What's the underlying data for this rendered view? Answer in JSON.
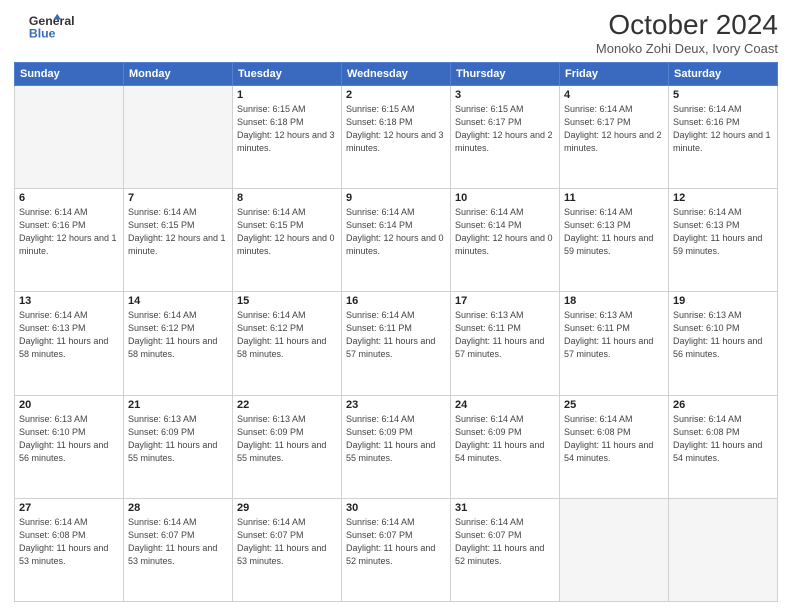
{
  "header": {
    "logo_line1": "General",
    "logo_line2": "Blue",
    "month_title": "October 2024",
    "subtitle": "Monoko Zohi Deux, Ivory Coast"
  },
  "days_of_week": [
    "Sunday",
    "Monday",
    "Tuesday",
    "Wednesday",
    "Thursday",
    "Friday",
    "Saturday"
  ],
  "weeks": [
    [
      {
        "day": "",
        "info": ""
      },
      {
        "day": "",
        "info": ""
      },
      {
        "day": "1",
        "info": "Sunrise: 6:15 AM\nSunset: 6:18 PM\nDaylight: 12 hours and 3 minutes."
      },
      {
        "day": "2",
        "info": "Sunrise: 6:15 AM\nSunset: 6:18 PM\nDaylight: 12 hours and 3 minutes."
      },
      {
        "day": "3",
        "info": "Sunrise: 6:15 AM\nSunset: 6:17 PM\nDaylight: 12 hours and 2 minutes."
      },
      {
        "day": "4",
        "info": "Sunrise: 6:14 AM\nSunset: 6:17 PM\nDaylight: 12 hours and 2 minutes."
      },
      {
        "day": "5",
        "info": "Sunrise: 6:14 AM\nSunset: 6:16 PM\nDaylight: 12 hours and 1 minute."
      }
    ],
    [
      {
        "day": "6",
        "info": "Sunrise: 6:14 AM\nSunset: 6:16 PM\nDaylight: 12 hours and 1 minute."
      },
      {
        "day": "7",
        "info": "Sunrise: 6:14 AM\nSunset: 6:15 PM\nDaylight: 12 hours and 1 minute."
      },
      {
        "day": "8",
        "info": "Sunrise: 6:14 AM\nSunset: 6:15 PM\nDaylight: 12 hours and 0 minutes."
      },
      {
        "day": "9",
        "info": "Sunrise: 6:14 AM\nSunset: 6:14 PM\nDaylight: 12 hours and 0 minutes."
      },
      {
        "day": "10",
        "info": "Sunrise: 6:14 AM\nSunset: 6:14 PM\nDaylight: 12 hours and 0 minutes."
      },
      {
        "day": "11",
        "info": "Sunrise: 6:14 AM\nSunset: 6:13 PM\nDaylight: 11 hours and 59 minutes."
      },
      {
        "day": "12",
        "info": "Sunrise: 6:14 AM\nSunset: 6:13 PM\nDaylight: 11 hours and 59 minutes."
      }
    ],
    [
      {
        "day": "13",
        "info": "Sunrise: 6:14 AM\nSunset: 6:13 PM\nDaylight: 11 hours and 58 minutes."
      },
      {
        "day": "14",
        "info": "Sunrise: 6:14 AM\nSunset: 6:12 PM\nDaylight: 11 hours and 58 minutes."
      },
      {
        "day": "15",
        "info": "Sunrise: 6:14 AM\nSunset: 6:12 PM\nDaylight: 11 hours and 58 minutes."
      },
      {
        "day": "16",
        "info": "Sunrise: 6:14 AM\nSunset: 6:11 PM\nDaylight: 11 hours and 57 minutes."
      },
      {
        "day": "17",
        "info": "Sunrise: 6:13 AM\nSunset: 6:11 PM\nDaylight: 11 hours and 57 minutes."
      },
      {
        "day": "18",
        "info": "Sunrise: 6:13 AM\nSunset: 6:11 PM\nDaylight: 11 hours and 57 minutes."
      },
      {
        "day": "19",
        "info": "Sunrise: 6:13 AM\nSunset: 6:10 PM\nDaylight: 11 hours and 56 minutes."
      }
    ],
    [
      {
        "day": "20",
        "info": "Sunrise: 6:13 AM\nSunset: 6:10 PM\nDaylight: 11 hours and 56 minutes."
      },
      {
        "day": "21",
        "info": "Sunrise: 6:13 AM\nSunset: 6:09 PM\nDaylight: 11 hours and 55 minutes."
      },
      {
        "day": "22",
        "info": "Sunrise: 6:13 AM\nSunset: 6:09 PM\nDaylight: 11 hours and 55 minutes."
      },
      {
        "day": "23",
        "info": "Sunrise: 6:14 AM\nSunset: 6:09 PM\nDaylight: 11 hours and 55 minutes."
      },
      {
        "day": "24",
        "info": "Sunrise: 6:14 AM\nSunset: 6:09 PM\nDaylight: 11 hours and 54 minutes."
      },
      {
        "day": "25",
        "info": "Sunrise: 6:14 AM\nSunset: 6:08 PM\nDaylight: 11 hours and 54 minutes."
      },
      {
        "day": "26",
        "info": "Sunrise: 6:14 AM\nSunset: 6:08 PM\nDaylight: 11 hours and 54 minutes."
      }
    ],
    [
      {
        "day": "27",
        "info": "Sunrise: 6:14 AM\nSunset: 6:08 PM\nDaylight: 11 hours and 53 minutes."
      },
      {
        "day": "28",
        "info": "Sunrise: 6:14 AM\nSunset: 6:07 PM\nDaylight: 11 hours and 53 minutes."
      },
      {
        "day": "29",
        "info": "Sunrise: 6:14 AM\nSunset: 6:07 PM\nDaylight: 11 hours and 53 minutes."
      },
      {
        "day": "30",
        "info": "Sunrise: 6:14 AM\nSunset: 6:07 PM\nDaylight: 11 hours and 52 minutes."
      },
      {
        "day": "31",
        "info": "Sunrise: 6:14 AM\nSunset: 6:07 PM\nDaylight: 11 hours and 52 minutes."
      },
      {
        "day": "",
        "info": ""
      },
      {
        "day": "",
        "info": ""
      }
    ]
  ]
}
